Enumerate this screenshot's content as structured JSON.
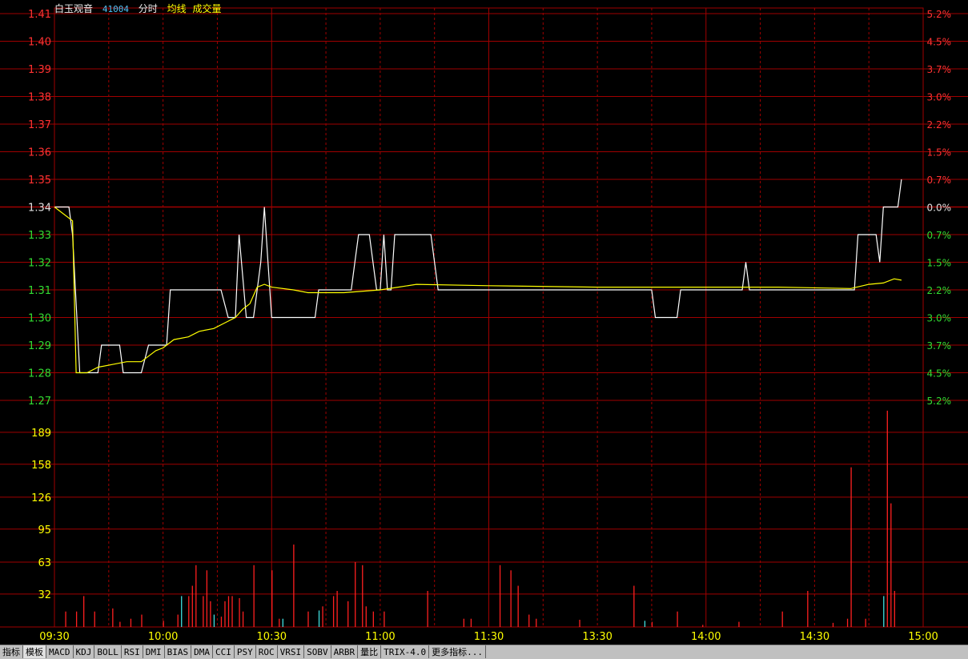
{
  "header": {
    "name": "白玉观音",
    "code": "41004",
    "mode": "分时",
    "avg_label": "均线",
    "vol_label": "成交量"
  },
  "colors": {
    "grid": "#a00000",
    "up": "#ff3232",
    "down": "#32dc32",
    "neutral": "#e0e0e0",
    "price_line": "#ffffff",
    "avg_line": "#ffff00",
    "vol_up": "#ff2020",
    "vol_down": "#40e0e0"
  },
  "tabs": [
    "指标",
    "模板",
    "MACD",
    "KDJ",
    "BOLL",
    "RSI",
    "DMI",
    "BIAS",
    "DMA",
    "CCI",
    "PSY",
    "ROC",
    "VRSI",
    "SOBV",
    "ARBR",
    "量比",
    "TRIX-4.0",
    "更多指标..."
  ],
  "chart_data": {
    "type": "line",
    "title": "白玉观音 41004 分时",
    "prev_close": 1.34,
    "price_axis": {
      "ylim": [
        1.27,
        1.41
      ],
      "ticks": [
        "1.41",
        "1.40",
        "1.39",
        "1.38",
        "1.37",
        "1.36",
        "1.35",
        "1.34",
        "1.33",
        "1.32",
        "1.31",
        "1.30",
        "1.29",
        "1.28",
        "1.27"
      ],
      "pct_ticks": [
        "5.2%",
        "4.5%",
        "3.7%",
        "3.0%",
        "2.2%",
        "1.5%",
        "0.7%",
        "0.0%",
        "0.7%",
        "1.5%",
        "2.2%",
        "3.0%",
        "3.7%",
        "4.5%",
        "5.2%"
      ]
    },
    "volume_axis": {
      "ylim": [
        0,
        220
      ],
      "ticks": [
        "189",
        "158",
        "126",
        "95",
        "63",
        "32"
      ]
    },
    "x_axis": {
      "minutes": 240,
      "labels": [
        "09:30",
        "10:00",
        "10:30",
        "11:00",
        "11:30",
        "13:30",
        "14:00",
        "14:30",
        "15:00"
      ]
    },
    "series": [
      {
        "name": "分时",
        "points": [
          [
            0,
            1.34
          ],
          [
            4,
            1.34
          ],
          [
            5,
            1.33
          ],
          [
            7,
            1.28
          ],
          [
            12,
            1.28
          ],
          [
            13,
            1.29
          ],
          [
            18,
            1.29
          ],
          [
            19,
            1.28
          ],
          [
            24,
            1.28
          ],
          [
            26,
            1.29
          ],
          [
            31,
            1.29
          ],
          [
            32,
            1.31
          ],
          [
            46,
            1.31
          ],
          [
            48,
            1.3
          ],
          [
            50,
            1.3
          ],
          [
            51,
            1.33
          ],
          [
            53,
            1.3
          ],
          [
            55,
            1.3
          ],
          [
            56,
            1.31
          ],
          [
            57,
            1.32
          ],
          [
            58,
            1.34
          ],
          [
            59,
            1.32
          ],
          [
            60,
            1.3
          ],
          [
            72,
            1.3
          ],
          [
            73,
            1.31
          ],
          [
            78,
            1.31
          ],
          [
            79,
            1.31
          ],
          [
            82,
            1.31
          ],
          [
            83,
            1.32
          ],
          [
            84,
            1.33
          ],
          [
            87,
            1.33
          ],
          [
            89,
            1.31
          ],
          [
            90,
            1.31
          ],
          [
            91,
            1.33
          ],
          [
            92,
            1.31
          ],
          [
            93,
            1.31
          ],
          [
            94,
            1.33
          ],
          [
            98,
            1.33
          ],
          [
            104,
            1.33
          ],
          [
            106,
            1.31
          ],
          [
            110,
            1.31
          ],
          [
            120,
            1.31
          ],
          [
            150,
            1.31
          ],
          [
            165,
            1.31
          ],
          [
            166,
            1.3
          ],
          [
            172,
            1.3
          ],
          [
            173,
            1.31
          ],
          [
            190,
            1.31
          ],
          [
            191,
            1.32
          ],
          [
            192,
            1.31
          ],
          [
            215,
            1.31
          ],
          [
            221,
            1.31
          ],
          [
            222,
            1.33
          ],
          [
            227,
            1.33
          ],
          [
            228,
            1.32
          ],
          [
            229,
            1.34
          ],
          [
            231,
            1.34
          ],
          [
            233,
            1.34
          ],
          [
            234,
            1.35
          ]
        ]
      },
      {
        "name": "均线",
        "points": [
          [
            0,
            1.34
          ],
          [
            5,
            1.335
          ],
          [
            6,
            1.28
          ],
          [
            9,
            1.28
          ],
          [
            12,
            1.282
          ],
          [
            16,
            1.283
          ],
          [
            20,
            1.284
          ],
          [
            24,
            1.284
          ],
          [
            26,
            1.286
          ],
          [
            28,
            1.288
          ],
          [
            30,
            1.289
          ],
          [
            33,
            1.292
          ],
          [
            37,
            1.293
          ],
          [
            40,
            1.295
          ],
          [
            44,
            1.296
          ],
          [
            47,
            1.298
          ],
          [
            50,
            1.3
          ],
          [
            52,
            1.303
          ],
          [
            54,
            1.305
          ],
          [
            56,
            1.311
          ],
          [
            58,
            1.312
          ],
          [
            60,
            1.311
          ],
          [
            66,
            1.31
          ],
          [
            70,
            1.309
          ],
          [
            80,
            1.309
          ],
          [
            90,
            1.31
          ],
          [
            95,
            1.311
          ],
          [
            100,
            1.312
          ],
          [
            120,
            1.3115
          ],
          [
            150,
            1.311
          ],
          [
            180,
            1.311
          ],
          [
            200,
            1.311
          ],
          [
            220,
            1.3105
          ],
          [
            225,
            1.312
          ],
          [
            229,
            1.3125
          ],
          [
            232,
            1.314
          ],
          [
            234,
            1.3135
          ]
        ]
      }
    ],
    "volume": [
      [
        3,
        15,
        "u"
      ],
      [
        6,
        15,
        "u"
      ],
      [
        8,
        30,
        "u"
      ],
      [
        11,
        15,
        "u"
      ],
      [
        16,
        18,
        "u"
      ],
      [
        18,
        5,
        "u"
      ],
      [
        21,
        8,
        "u"
      ],
      [
        24,
        12,
        "u"
      ],
      [
        30,
        6,
        "u"
      ],
      [
        34,
        12,
        "u"
      ],
      [
        35,
        30,
        "d"
      ],
      [
        37,
        30,
        "u"
      ],
      [
        38,
        40,
        "u"
      ],
      [
        39,
        60,
        "u"
      ],
      [
        41,
        30,
        "u"
      ],
      [
        42,
        55,
        "u"
      ],
      [
        43,
        25,
        "u"
      ],
      [
        44,
        12,
        "d"
      ],
      [
        46,
        10,
        "u"
      ],
      [
        47,
        25,
        "u"
      ],
      [
        48,
        30,
        "u"
      ],
      [
        49,
        30,
        "u"
      ],
      [
        51,
        28,
        "u"
      ],
      [
        52,
        15,
        "u"
      ],
      [
        55,
        60,
        "u"
      ],
      [
        60,
        55,
        "u"
      ],
      [
        62,
        8,
        "u"
      ],
      [
        63,
        8,
        "d"
      ],
      [
        66,
        80,
        "u"
      ],
      [
        70,
        15,
        "u"
      ],
      [
        73,
        16,
        "d"
      ],
      [
        74,
        20,
        "u"
      ],
      [
        77,
        30,
        "u"
      ],
      [
        78,
        35,
        "u"
      ],
      [
        81,
        25,
        "u"
      ],
      [
        83,
        63,
        "u"
      ],
      [
        85,
        60,
        "u"
      ],
      [
        86,
        20,
        "u"
      ],
      [
        88,
        15,
        "u"
      ],
      [
        91,
        15,
        "u"
      ],
      [
        103,
        35,
        "u"
      ],
      [
        113,
        8,
        "u"
      ],
      [
        115,
        8,
        "u"
      ],
      [
        123,
        60,
        "u"
      ],
      [
        126,
        55,
        "u"
      ],
      [
        128,
        40,
        "u"
      ],
      [
        131,
        12,
        "u"
      ],
      [
        133,
        8,
        "u"
      ],
      [
        145,
        7,
        "u"
      ],
      [
        160,
        40,
        "u"
      ],
      [
        163,
        6,
        "d"
      ],
      [
        165,
        5,
        "u"
      ],
      [
        172,
        15,
        "u"
      ],
      [
        179,
        2,
        "u"
      ],
      [
        189,
        5,
        "u"
      ],
      [
        201,
        15,
        "u"
      ],
      [
        208,
        35,
        "u"
      ],
      [
        215,
        4,
        "u"
      ],
      [
        219,
        8,
        "u"
      ],
      [
        220,
        155,
        "u"
      ],
      [
        224,
        8,
        "u"
      ],
      [
        229,
        30,
        "d"
      ],
      [
        230,
        210,
        "u"
      ],
      [
        231,
        120,
        "u"
      ],
      [
        232,
        35,
        "u"
      ]
    ]
  }
}
